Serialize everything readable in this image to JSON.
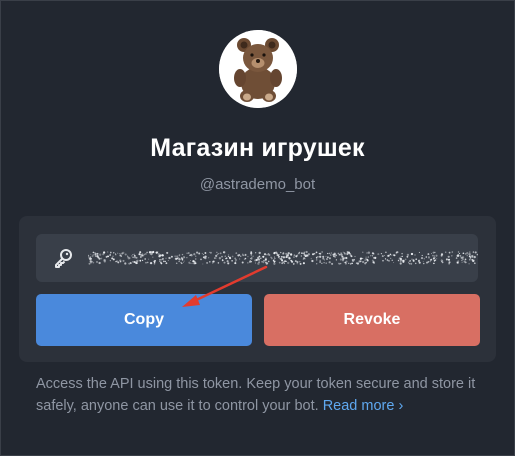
{
  "bot": {
    "name": "Магазин игрушек",
    "username": "@astrademo_bot",
    "avatar_icon": "teddy-bear-avatar"
  },
  "token": {
    "icon": "key-icon",
    "masked": true
  },
  "buttons": {
    "copy_label": "Copy",
    "revoke_label": "Revoke"
  },
  "info": {
    "text": "Access the API using this token. Keep your token secure and store it safely, anyone can use it to control your bot. ",
    "link_label": "Read more ›"
  },
  "colors": {
    "background": "#222730",
    "card": "#2c313a",
    "field": "#393f49",
    "copy": "#4a89dc",
    "revoke": "#d86f63",
    "link": "#5fa8f0",
    "arrow": "#e23b2e"
  }
}
